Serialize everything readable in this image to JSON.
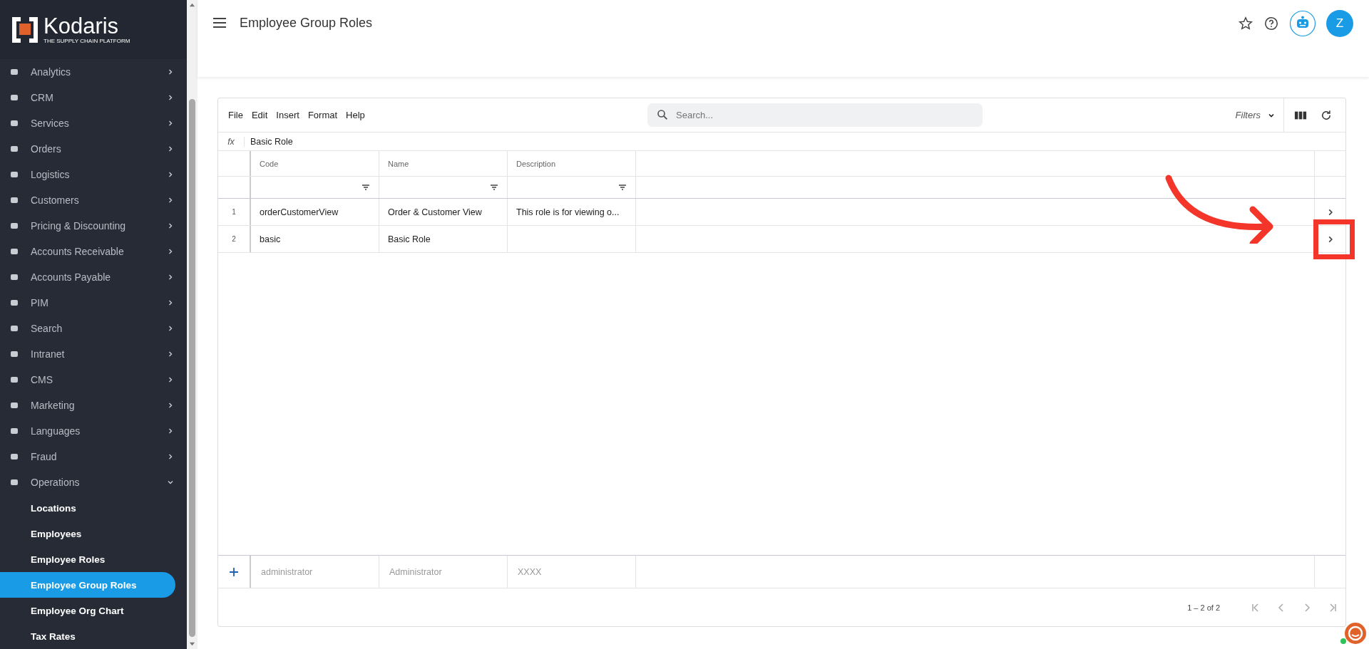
{
  "sidebar": {
    "logo": {
      "name": "Kodaris",
      "tagline": "THE SUPPLY CHAIN PLATFORM"
    },
    "items": [
      {
        "label": "Analytics",
        "expanded": false
      },
      {
        "label": "CRM",
        "expanded": false
      },
      {
        "label": "Services",
        "expanded": false
      },
      {
        "label": "Orders",
        "expanded": false
      },
      {
        "label": "Logistics",
        "expanded": false
      },
      {
        "label": "Customers",
        "expanded": false
      },
      {
        "label": "Pricing & Discounting",
        "expanded": false
      },
      {
        "label": "Accounts Receivable",
        "expanded": false
      },
      {
        "label": "Accounts Payable",
        "expanded": false
      },
      {
        "label": "PIM",
        "expanded": false
      },
      {
        "label": "Search",
        "expanded": false
      },
      {
        "label": "Intranet",
        "expanded": false
      },
      {
        "label": "CMS",
        "expanded": false
      },
      {
        "label": "Marketing",
        "expanded": false
      },
      {
        "label": "Languages",
        "expanded": false
      },
      {
        "label": "Fraud",
        "expanded": false
      },
      {
        "label": "Operations",
        "expanded": true,
        "children": [
          {
            "label": "Locations",
            "selected": false
          },
          {
            "label": "Employees",
            "selected": false
          },
          {
            "label": "Employee Roles",
            "selected": false
          },
          {
            "label": "Employee Group Roles",
            "selected": true
          },
          {
            "label": "Employee Org Chart",
            "selected": false
          },
          {
            "label": "Tax Rates",
            "selected": false
          }
        ]
      }
    ]
  },
  "header": {
    "title": "Employee Group Roles",
    "avatar": "Z"
  },
  "grid": {
    "menu": [
      "File",
      "Edit",
      "Insert",
      "Format",
      "Help"
    ],
    "search": {
      "placeholder": "Search..."
    },
    "filters": "Filters",
    "formula": {
      "symbol": "fx",
      "value": "Basic Role"
    },
    "columns": [
      "Code",
      "Name",
      "Description"
    ],
    "rows": [
      {
        "number": "1",
        "cells": [
          "orderCustomerView",
          "Order & Customer View",
          "This role is for viewing o..."
        ],
        "highlighted": false
      },
      {
        "number": "2",
        "cells": [
          "basic",
          "Basic Role",
          ""
        ],
        "highlighted": true
      }
    ],
    "new_row": {
      "placeholders": [
        "administrator",
        "Administrator",
        "XXXX"
      ]
    },
    "pagination": "1 – 2 of 2"
  }
}
